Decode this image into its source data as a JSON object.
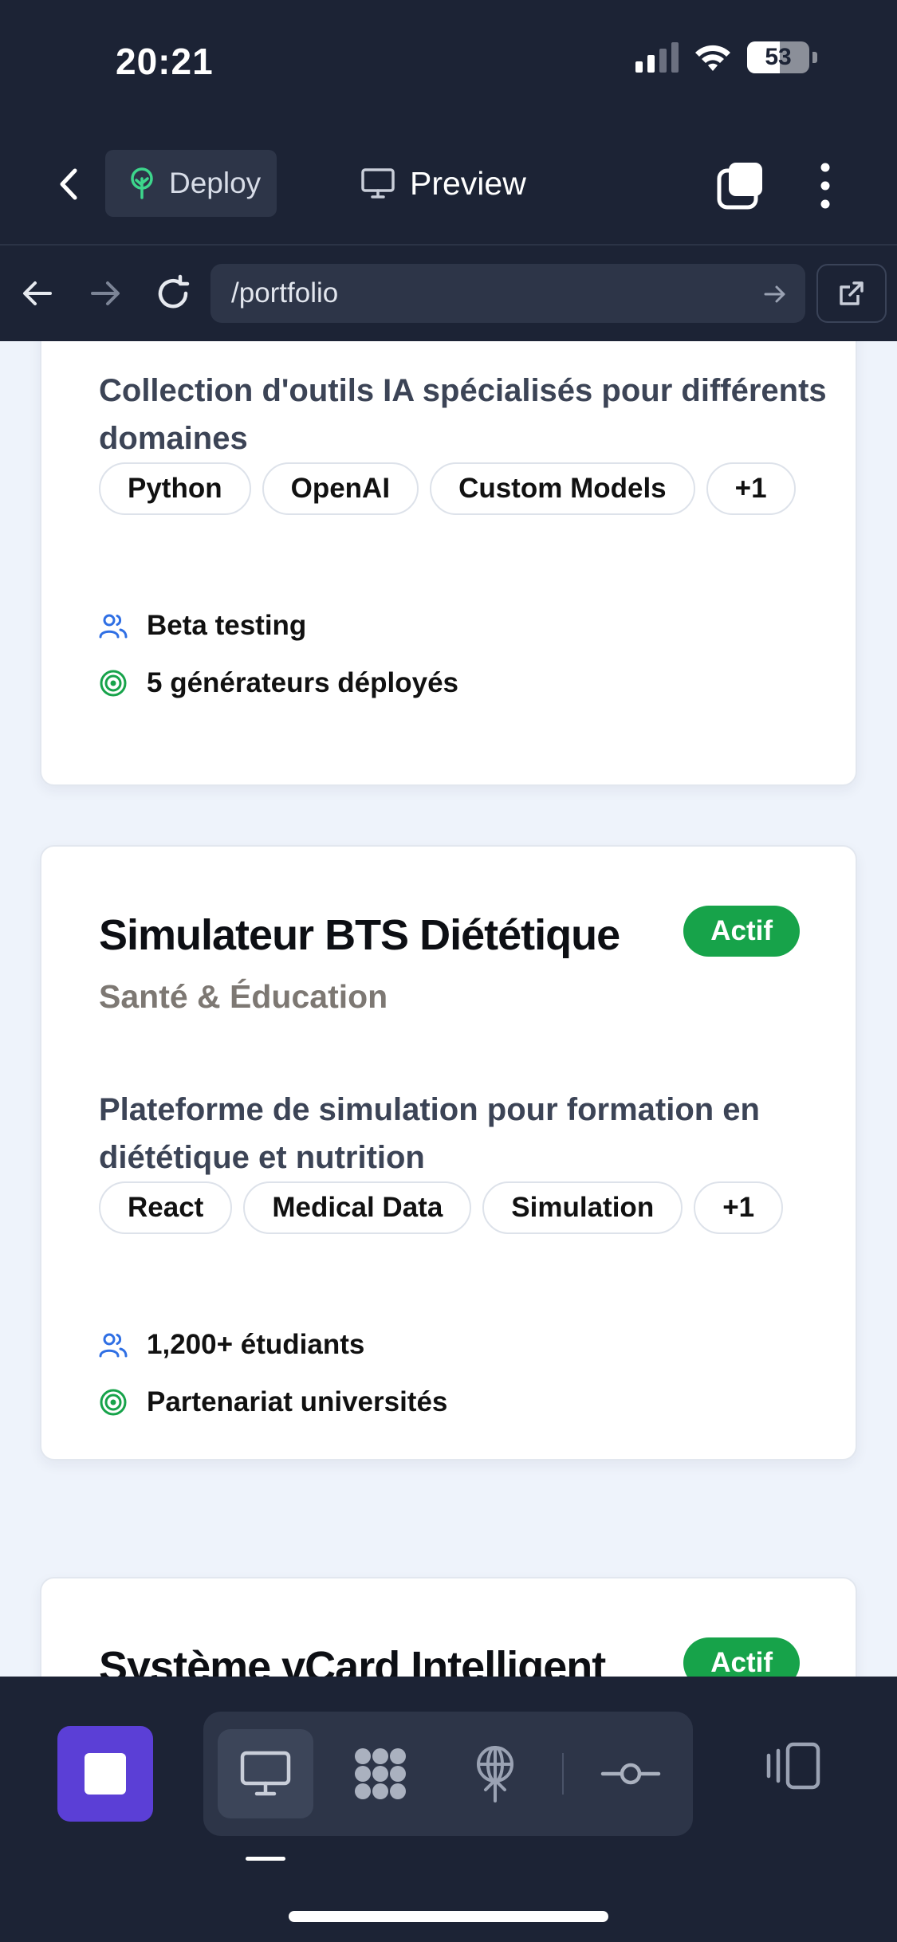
{
  "status_bar": {
    "time": "20:21",
    "battery": "53"
  },
  "toolbar": {
    "deploy_label": "Deploy",
    "preview_label": "Preview"
  },
  "url_bar": {
    "path": "/portfolio"
  },
  "cards": [
    {
      "description": "Collection d'outils IA spécialisés pour différents domaines",
      "tags": [
        "Python",
        "OpenAI",
        "Custom Models",
        "+1"
      ],
      "metrics": [
        "Beta testing",
        "5 générateurs déployés"
      ]
    },
    {
      "title": "Simulateur BTS Diététique",
      "category": "Santé & Éducation",
      "status": "Actif",
      "description": "Plateforme de simulation pour formation en diététique et nutrition",
      "tags": [
        "React",
        "Medical Data",
        "Simulation",
        "+1"
      ],
      "metrics": [
        "1,200+ étudiants",
        "Partenariat universités"
      ]
    },
    {
      "title": "Système vCard Intelligent",
      "status": "Actif"
    }
  ],
  "colors": {
    "chrome_bg": "#1c2335",
    "pill_bg": "#2d3548",
    "status_active": "#17a34a",
    "stop_button": "#5b3fd6",
    "users_icon": "#2f6fe4",
    "target_icon": "#17a34a"
  },
  "icons": {
    "back": "chevron-left-icon",
    "deploy": "tree-icon",
    "preview": "monitor-icon",
    "tabs": "tabs-icon",
    "more": "more-vertical-icon",
    "reload": "reload-icon",
    "external": "external-link-icon",
    "users": "users-icon",
    "target": "target-icon",
    "desktop": "desktop-icon",
    "grid": "component-icon",
    "network": "network-icon",
    "commit": "commit-icon",
    "panel": "side-panel-icon"
  }
}
